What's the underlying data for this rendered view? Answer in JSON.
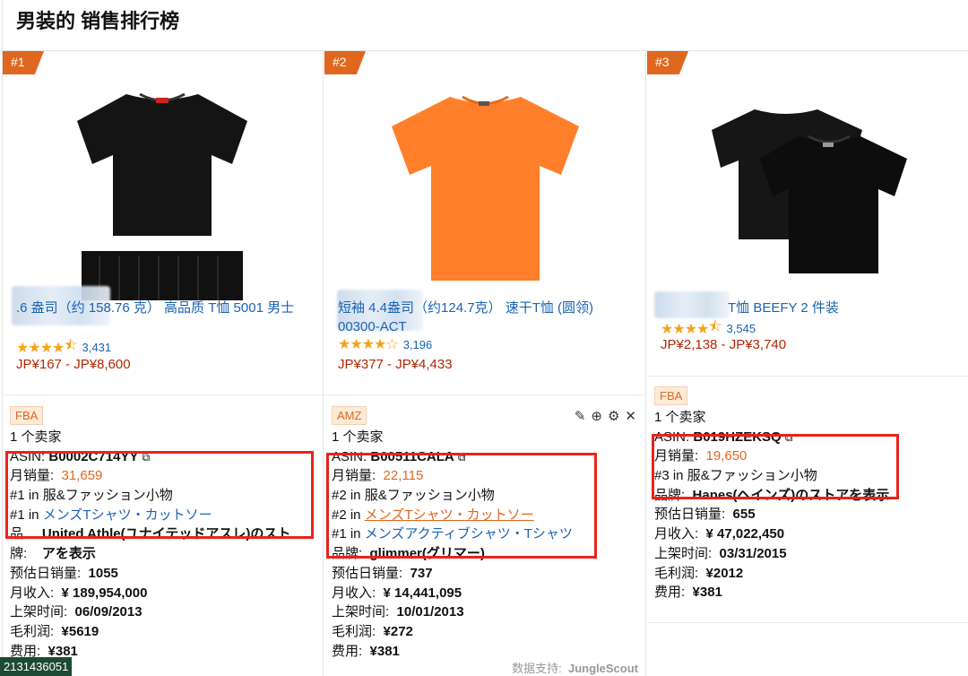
{
  "page": {
    "title": "男装的 销售排行榜"
  },
  "cards": [
    {
      "rank": "#1",
      "title": ".6 盎司（约 158.76 克） 高品质 T恤 5001 男士",
      "rating": 4.5,
      "reviews": "3,431",
      "price": "JP¥167 - JP¥8,600",
      "badge": "FBA",
      "sellers": "1 个卖家",
      "asin_label": "ASIN:",
      "asin": "B0002C714YY",
      "monthly_sales_label": "月销量:",
      "monthly_sales": "31,659",
      "rank_line1": "#1 in 服&ファッション小物",
      "rank_line2_prefix": "#1 in",
      "rank_line2_link": "メンズTシャツ・カットソー",
      "brand_label": "品",
      "brand": "United Athle(ユナイテッドアスレ)のスト",
      "brand_label2": "牌:",
      "brand_cont": "アを表示",
      "daily_label": "预估日销量:",
      "daily": "1055",
      "revenue_label": "月收入:",
      "revenue": "¥ 189,954,000",
      "listed_label": "上架时间:",
      "listed": "06/09/2013",
      "margin_label": "毛利润:",
      "margin": "¥5619",
      "fee_label": "费用:",
      "fee": "¥381"
    },
    {
      "rank": "#2",
      "title": "短袖 4.4盎司（约124.7克） 速干T恤 (圆领) 00300-ACT",
      "rating": 4.0,
      "reviews": "3,196",
      "price": "JP¥377 - JP¥4,433",
      "badge": "AMZ",
      "sellers": "1 个卖家",
      "asin_label": "ASIN:",
      "asin": "B00511CALA",
      "monthly_sales_label": "月销量:",
      "monthly_sales": "22,115",
      "rank_line1": "#2 in 服&ファッション小物",
      "rank_line2_prefix": "#2 in",
      "rank_line2_link": "メンズTシャツ・カットソー",
      "rank_line3_prefix": "#1 in",
      "rank_line3_link": "メンズアクティブシャツ・Tシャツ",
      "brand_label": "品牌:",
      "brand": "glimmer(グリマー)",
      "daily_label": "预估日销量:",
      "daily": "737",
      "revenue_label": "月收入:",
      "revenue": "¥ 14,441,095",
      "listed_label": "上架时间:",
      "listed": "10/01/2013",
      "margin_label": "毛利润:",
      "margin": "¥272",
      "fee_label": "费用:",
      "fee": "¥381"
    },
    {
      "rank": "#3",
      "title": "T恤 BEEFY 2 件装",
      "rating": 4.5,
      "reviews": "3,545",
      "price": "JP¥2,138 - JP¥3,740",
      "badge": "FBA",
      "sellers": "1 个卖家",
      "asin_label": "ASIN:",
      "asin": "B019HZEKSQ",
      "monthly_sales_label": "月销量:",
      "monthly_sales": "19,650",
      "rank_line1": "#3 in 服&ファッション小物",
      "brand_label": "品牌:",
      "brand": "Hanes(ヘインズ)のストアを表示",
      "daily_label": "预估日销量:",
      "daily": "655",
      "revenue_label": "月收入:",
      "revenue": "¥ 47,022,450",
      "listed_label": "上架时间:",
      "listed": "03/31/2015",
      "margin_label": "毛利润:",
      "margin": "¥2012",
      "fee_label": "费用:",
      "fee": "¥381"
    }
  ],
  "footer": {
    "code": "2131436051",
    "credit_prefix": "数据支持:",
    "credit_brand": "JungleScout"
  },
  "colors": {
    "accent": "#e0671f",
    "link": "#1a63b3",
    "price": "#b12704",
    "highlight": "#e8241b"
  },
  "icons": [
    "copy-icon",
    "pencil-icon",
    "plus-circle-icon",
    "gear-icon",
    "close-icon",
    "star-icon"
  ]
}
